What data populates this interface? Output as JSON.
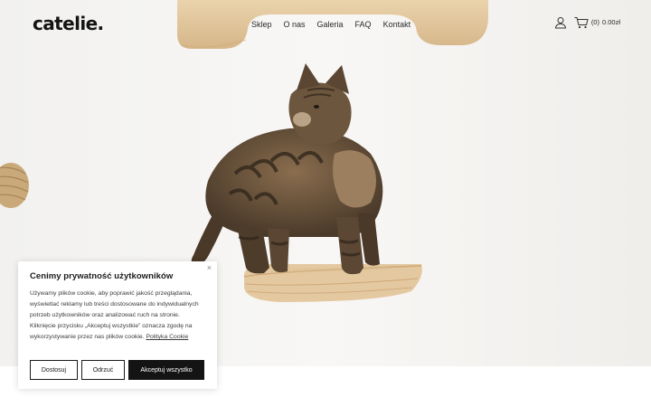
{
  "brand": {
    "logo": "catelie."
  },
  "nav": {
    "items": [
      {
        "label": "Sklep"
      },
      {
        "label": "O nas"
      },
      {
        "label": "Galeria"
      },
      {
        "label": "FAQ"
      },
      {
        "label": "Kontakt"
      }
    ]
  },
  "cart": {
    "count": "(0)",
    "total": "0.00zł"
  },
  "icons": {
    "account": "user-icon",
    "cart": "cart-icon",
    "close": "close-icon"
  },
  "cookie": {
    "title": "Cenimy prywatność użytkowników",
    "text": "Używamy plików cookie, aby poprawić jakość przeglądania, wyświetlać reklamy lub treści dostosowane do indywidualnych potrzeb użytkowników oraz analizować ruch na stronie. Kliknięcie przycisku „Akceptuj wszystkie” oznacza zgodę na wykorzystywanie przez nas plików cookie.",
    "link": "Polityka Cookie",
    "close": "×",
    "buttons": {
      "customize": "Dostosuj",
      "reject": "Odrzuć",
      "accept": "Akceptuj wszystko"
    }
  },
  "colors": {
    "text": "#1b1b1b",
    "button_dark": "#141414",
    "wood": "#e2c79e",
    "hero_bg": "#f4f3f1"
  }
}
